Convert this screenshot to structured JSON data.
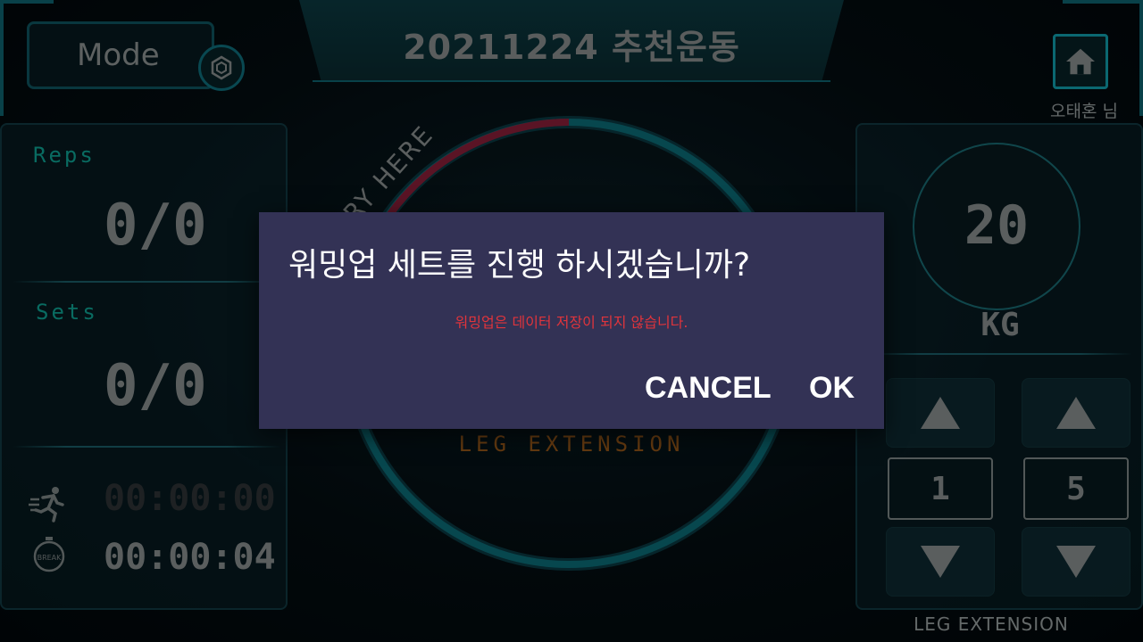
{
  "header": {
    "title": "20211224 추천운동",
    "mode_label": "Mode",
    "user_name": "오태혼 님"
  },
  "left_panel": {
    "reps_label": "Reps",
    "reps_value": "0/0",
    "sets_label": "Sets",
    "sets_value": "0/0",
    "exercise_time": "00:00:00",
    "break_time": "00:00:04",
    "break_icon_text": "BREAK"
  },
  "center": {
    "try_here": "TRY HERE",
    "exercise_name": "LEG EXTENSION",
    "progress_fraction": 0.0
  },
  "right_panel": {
    "weight_value": "20",
    "weight_unit": "KG",
    "step_left": "1",
    "step_right": "5",
    "bottom_label": "LEG EXTENSION"
  },
  "dialog": {
    "title": "워밍업 세트를 진행 하시겠습니까?",
    "message": "워밍업은 데이터 저장이 되지 않습니다.",
    "cancel_label": "CANCEL",
    "ok_label": "OK"
  },
  "icons": {
    "mode": "mode-icon",
    "home": "home-icon",
    "run": "running-icon",
    "stopwatch": "stopwatch-icon"
  },
  "colors": {
    "accent": "#0fa596",
    "frame": "#0e6470",
    "ring": "#0c6d78",
    "ring_highlight": "#8a1f3a",
    "dialog_bg": "#333255",
    "dialog_msg": "#e0343c",
    "exercise_label": "#9a5a1a"
  }
}
